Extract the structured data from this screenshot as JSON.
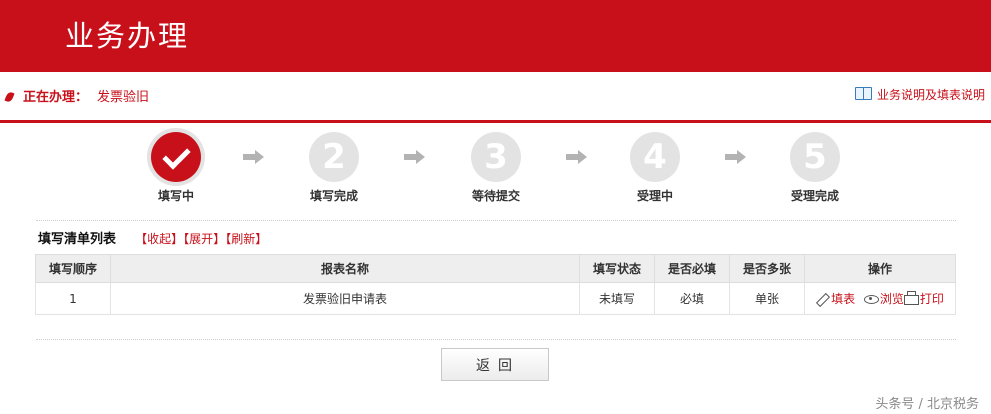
{
  "header": {
    "title": "业务办理"
  },
  "status_bar": {
    "label": "正在办理：",
    "value": "发票验旧",
    "help_link": "业务说明及填表说明"
  },
  "steps": [
    {
      "label": "填写中",
      "number": "",
      "state": "active"
    },
    {
      "label": "填写完成",
      "number": "2",
      "state": "pending"
    },
    {
      "label": "等待提交",
      "number": "3",
      "state": "pending"
    },
    {
      "label": "受理中",
      "number": "4",
      "state": "pending"
    },
    {
      "label": "受理完成",
      "number": "5",
      "state": "pending"
    }
  ],
  "list": {
    "title": "填写清单列表",
    "actions": {
      "collapse": "收起",
      "expand": "展开",
      "refresh": "刷新"
    },
    "columns": [
      "填写顺序",
      "报表名称",
      "填写状态",
      "是否必填",
      "是否多张",
      "操作"
    ],
    "rows": [
      {
        "order": "1",
        "name": "发票验旧申请表",
        "status": "未填写",
        "required": "必填",
        "multiple": "单张",
        "ops": {
          "fill": "填表",
          "browse": "浏览",
          "print": "打印"
        }
      }
    ]
  },
  "back_button": "返回",
  "watermark": "头条号 / 北京税务",
  "colors": {
    "brand_red": "#c8101a",
    "step_pending": "#e3e3e3"
  }
}
